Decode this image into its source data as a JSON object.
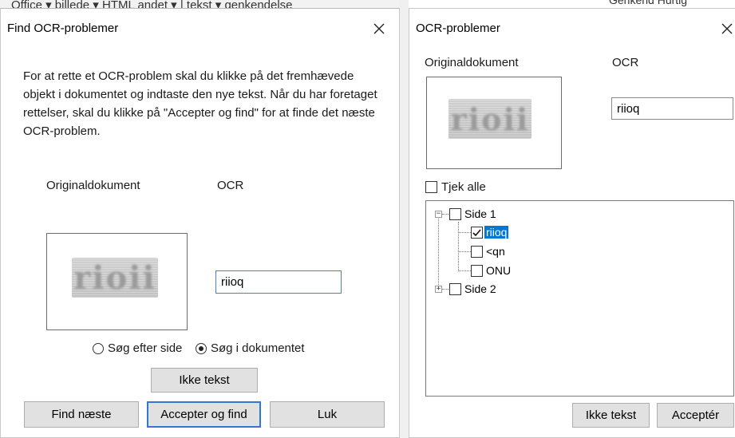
{
  "background_app": {
    "menu_left": "Office ▾   billede ▾   HTML   andet ▾   |   tekst ▾   genkendelse",
    "menu_right": "Genkend     Hurtig"
  },
  "find_dialog": {
    "title": "Find OCR-problemer",
    "instructions": "For at rette et OCR-problem skal du klikke på det fremhævede objekt i dokumentet og indtaste den nye tekst. Når du har foretaget rettelser, skal du klikke på \"Accepter og find\" for at finde det næste OCR-problem.",
    "original_label": "Originaldokument",
    "ocr_label": "OCR",
    "scan_text": "rioii",
    "ocr_value": "riioq",
    "radio_page": "Søg efter side",
    "radio_doc": "Søg i dokumentet",
    "radio_selected": "doc",
    "not_text_button": "Ikke tekst",
    "find_next_button": "Find næste",
    "accept_find_button": "Accepter og find",
    "close_button": "Luk"
  },
  "problems_dialog": {
    "title": "OCR-problemer",
    "original_label": "Originaldokument",
    "ocr_label": "OCR",
    "scan_text": "rioii",
    "ocr_value": "riioq",
    "check_all_label": "Tjek alle",
    "tree": {
      "page1": "Side 1",
      "item1": "riioq",
      "item2": "<qn",
      "item3": "ONU",
      "page2": "Side 2"
    },
    "not_text_button": "Ikke tekst",
    "accept_button": "Acceptér"
  },
  "colors": {
    "accent": "#2f79d3",
    "selection": "#0078d7",
    "button_face": "#e1e1e1"
  }
}
